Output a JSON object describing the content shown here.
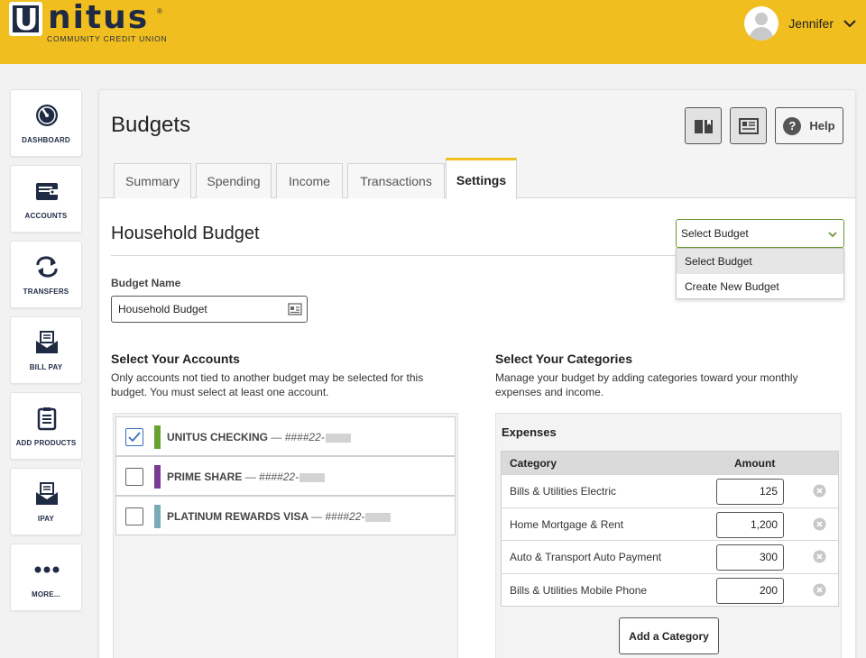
{
  "brand": {
    "logo_letter": "U",
    "name": "nitus",
    "registered": "®",
    "tagline": "COMMUNITY CREDIT UNION",
    "color": "#f0be1e"
  },
  "user": {
    "name": "Jennifer",
    "icon": "chevron-down-icon"
  },
  "sidebar": {
    "items": [
      {
        "label": "DASHBOARD",
        "icon": "dashboard-icon"
      },
      {
        "label": "ACCOUNTS",
        "icon": "wallet-icon"
      },
      {
        "label": "TRANSFERS",
        "icon": "transfer-icon"
      },
      {
        "label": "BILL PAY",
        "icon": "envelope-icon"
      },
      {
        "label": "ADD PRODUCTS",
        "icon": "clipboard-icon"
      },
      {
        "label": "IPAY",
        "icon": "envelope-icon"
      },
      {
        "label": "MORE...",
        "icon": "more-icon"
      }
    ]
  },
  "page": {
    "title": "Budgets",
    "help_label": "Help"
  },
  "tabs": [
    {
      "label": "Summary"
    },
    {
      "label": "Spending"
    },
    {
      "label": "Income"
    },
    {
      "label": "Transactions"
    },
    {
      "label": "Settings",
      "active": true
    }
  ],
  "budget": {
    "section_title": "Household Budget",
    "select_value": "Select Budget",
    "dropdown_options": [
      "Select Budget",
      "Create New Budget"
    ],
    "name_label": "Budget Name",
    "name_value": "Household Budget"
  },
  "accounts_section": {
    "title": "Select Your Accounts",
    "description": "Only accounts not tied to another budget may be selected for this budget. You must select at least one account.",
    "items": [
      {
        "name": "UNITUS CHECKING",
        "number": "— ####22-",
        "checked": true,
        "color": "#6aa232"
      },
      {
        "name": "PRIME SHARE",
        "number": "— ####22-",
        "checked": false,
        "color": "#7a3b94"
      },
      {
        "name": "PLATINUM REWARDS VISA",
        "number": "— ####22-",
        "checked": false,
        "color": "#7aaab8"
      }
    ]
  },
  "categories_section": {
    "title": "Select Your Categories",
    "description": "Manage your budget by adding categories toward your monthly expenses and income.",
    "expenses_title": "Expenses",
    "headers": {
      "category": "Category",
      "amount": "Amount"
    },
    "rows": [
      {
        "category": "Bills & Utilities Electric",
        "amount": "125"
      },
      {
        "category": "Home Mortgage & Rent",
        "amount": "1,200"
      },
      {
        "category": "Auto & Transport Auto Payment",
        "amount": "300"
      },
      {
        "category": "Bills & Utilities Mobile Phone",
        "amount": "200"
      }
    ],
    "add_label": "Add a Category"
  }
}
